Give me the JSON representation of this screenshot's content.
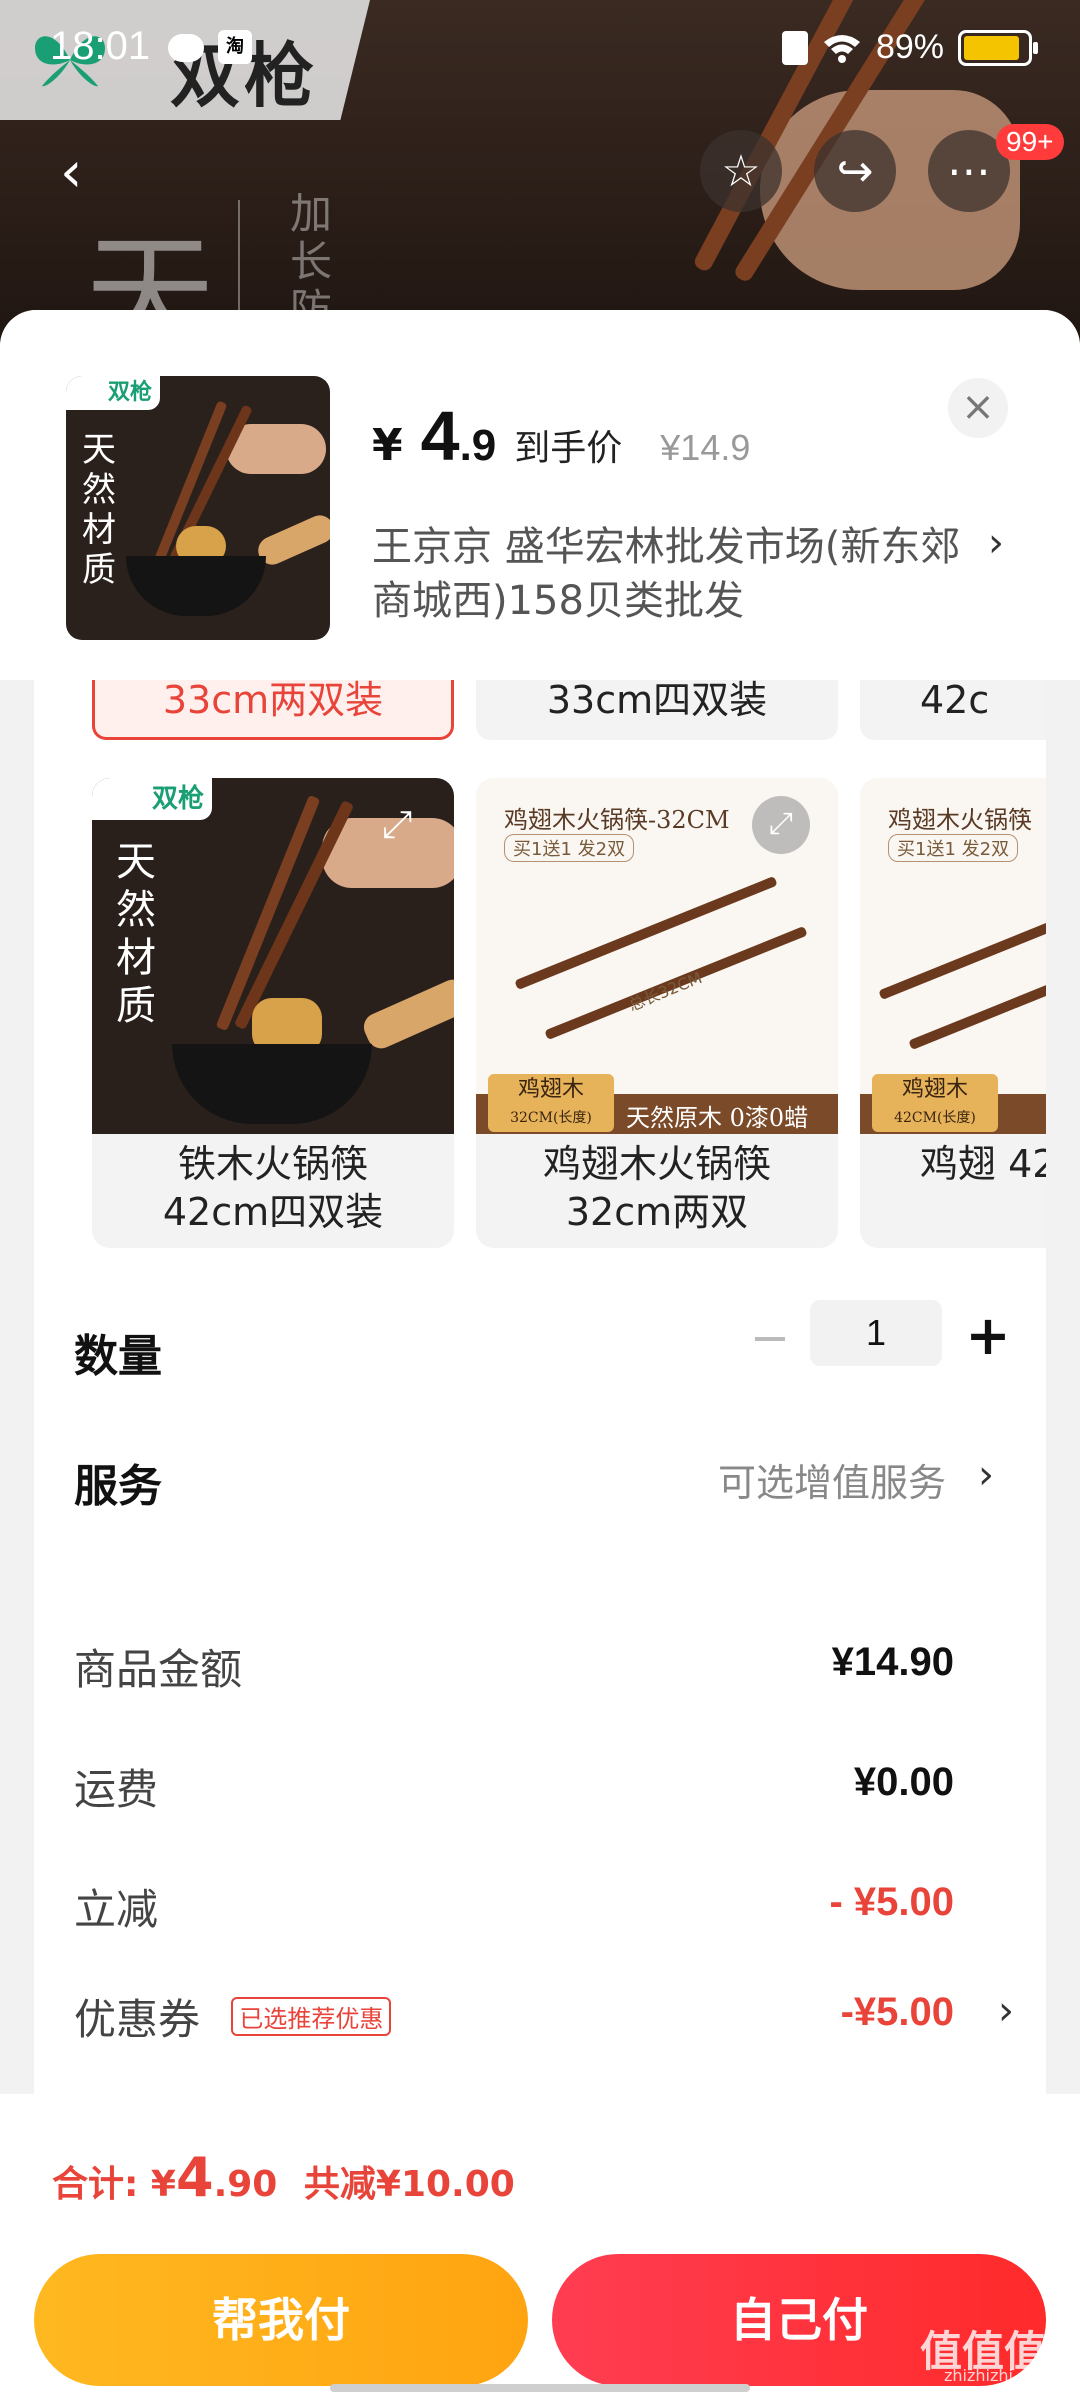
{
  "status_bar": {
    "time": "18:01",
    "taobao_icon": "淘",
    "battery_pct": "89%",
    "battery_level": 0.89
  },
  "background": {
    "brand": "双枪",
    "big_char": "天",
    "vertical_text": "加长防"
  },
  "header": {
    "badge": "99+"
  },
  "product": {
    "thumb_brand": "双枪",
    "thumb_title": "天然材质",
    "price_currency": "¥",
    "price_int": "4",
    "price_dec": ".9",
    "price_label": "到手价",
    "original_price": "¥14.9",
    "seller": "王京京  盛华宏林批发市场(新东郊商城西)158贝类批发"
  },
  "variants_top": [
    {
      "label": "33cm两双装",
      "selected": true
    },
    {
      "label": "33cm四双装",
      "selected": false
    },
    {
      "label": "42c",
      "selected": false
    }
  ],
  "variant_cards": [
    {
      "caption": "铁木火锅筷\n42cm四双装",
      "brand": "双枪",
      "title": "天然材质"
    },
    {
      "caption": "鸡翅木火锅筷\n32cm两双",
      "ad_title": "鸡翅木火锅筷-32CM",
      "ad_sub": "买1送1 发2双",
      "tag": "鸡翅木",
      "tag_sub": "32CM(长度)",
      "band_text": "天然原木 0漆0蜡",
      "dim": "总长32CM"
    },
    {
      "caption": "鸡翅\n42",
      "ad_title": "鸡翅木火锅筷",
      "ad_sub": "买1送1 发2双",
      "tag": "鸡翅木",
      "tag_sub": "42CM(长度)"
    }
  ],
  "quantity": {
    "label": "数量",
    "value": "1",
    "minus": "−",
    "plus": "+"
  },
  "service": {
    "label": "服务",
    "value": "可选增值服务"
  },
  "summary": {
    "goods_label": "商品金额",
    "goods_value": "¥14.90",
    "shipping_label": "运费",
    "shipping_value": "¥0.00",
    "discount_label": "立减",
    "discount_value": "- ¥5.00",
    "coupon_label": "优惠券",
    "coupon_tag": "已选推荐优惠",
    "coupon_value": "-¥5.00"
  },
  "bottom": {
    "total_prefix": "合计: ¥",
    "total_int": "4",
    "total_dec": ".90",
    "total_saving": "共减¥10.00",
    "help_pay": "帮我付",
    "self_pay": "自己付"
  },
  "watermark": {
    "text": "值值值",
    "sub": "zhizhizhi.com"
  },
  "colors": {
    "accent_red": "#e8443a",
    "help_btn": "#ffb820",
    "self_btn": "#ff3d52"
  }
}
